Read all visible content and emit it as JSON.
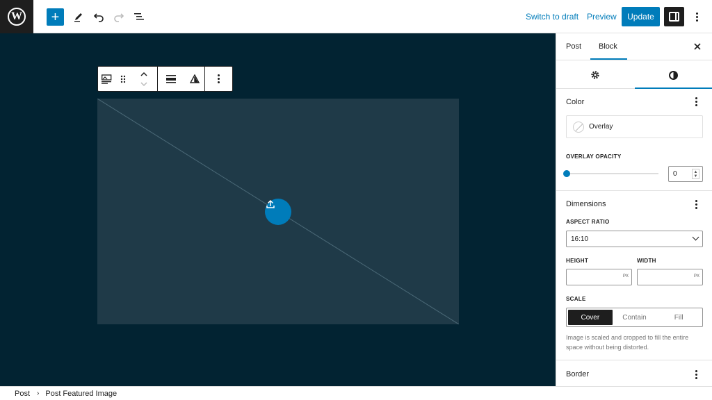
{
  "topbar": {
    "logo_letter": "W",
    "add_icon": "plus-icon",
    "switch_to_draft": "Switch to draft",
    "preview": "Preview",
    "update": "Update",
    "accent": "#007cba"
  },
  "toolbar": {
    "items": [
      "featured-image-icon",
      "drag-handle-icon",
      "move-up-down-icon",
      "align-icon",
      "warning-icon",
      "more-options-icon"
    ]
  },
  "sidebar": {
    "tabs": [
      "Post",
      "Block"
    ],
    "active_tab": "Block",
    "close_icon": "close-icon",
    "subtabs": [
      "settings",
      "styles"
    ],
    "color": {
      "title": "Color",
      "overlay_label": "Overlay",
      "overlay_opacity_label": "OVERLAY OPACITY",
      "overlay_opacity_value": "0"
    },
    "dimensions": {
      "title": "Dimensions",
      "aspect_ratio_label": "ASPECT RATIO",
      "aspect_ratio_value": "16:10",
      "height_label": "HEIGHT",
      "width_label": "WIDTH",
      "unit": "PX",
      "scale_label": "SCALE",
      "scale_options": [
        "Cover",
        "Contain",
        "Fill"
      ],
      "scale_selected": "Cover",
      "help_text": "Image is scaled and cropped to fill the entire space without being distorted."
    },
    "border": {
      "title": "Border"
    }
  },
  "breadcrumb": {
    "items": [
      "Post",
      "Post Featured Image"
    ]
  }
}
